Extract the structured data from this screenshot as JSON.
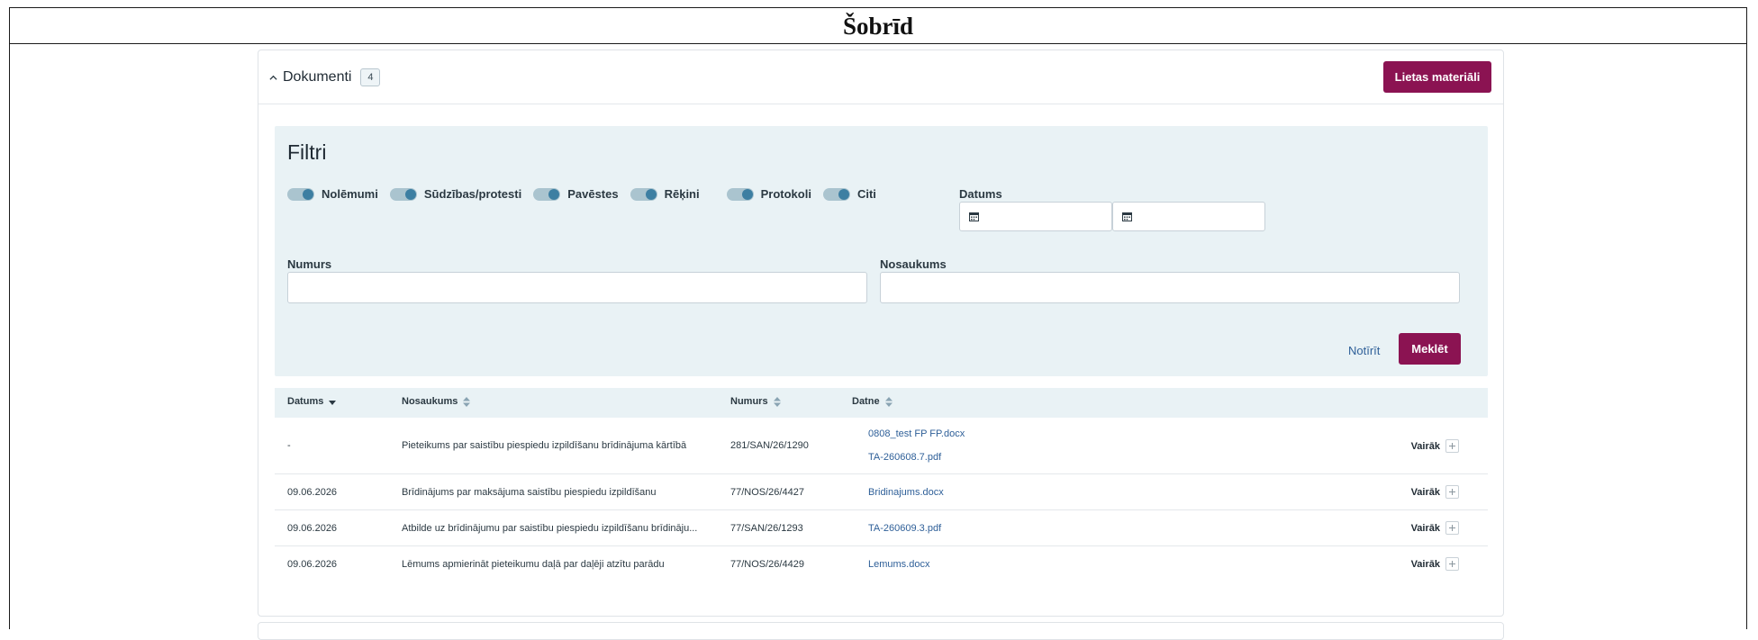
{
  "page": {
    "heading": "Šobrīd"
  },
  "documents": {
    "title": "Dokumenti",
    "count": "4",
    "case_materials_button": "Lietas materiāli"
  },
  "filters": {
    "title": "Filtri",
    "toggles": [
      {
        "label": "Nolēmumi",
        "checked": true
      },
      {
        "label": "Sūdzības/protesti",
        "checked": true
      },
      {
        "label": "Pavēstes",
        "checked": true
      },
      {
        "label": "Rēķini",
        "checked": true
      },
      {
        "label": "Protokoli",
        "checked": true
      },
      {
        "label": "Citi",
        "checked": true
      }
    ],
    "date_label": "Datums",
    "date_from": "",
    "date_to": "",
    "number_label": "Numurs",
    "number_value": "",
    "name_label": "Nosaukums",
    "name_value": "",
    "clear_label": "Notīrīt",
    "search_label": "Meklēt"
  },
  "table": {
    "columns": [
      "Datums",
      "Nosaukums",
      "Numurs",
      "Datne"
    ],
    "more_label": "Vairāk",
    "rows": [
      {
        "date": "-",
        "name": "Pieteikums par saistību piespiedu izpildīšanu brīdinājuma kārtībā",
        "number": "281/SAN/26/1290",
        "files": [
          "0808_test FP FP.docx",
          "TA-260608.7.pdf"
        ]
      },
      {
        "date": "09.06.2026",
        "name": "Brīdinājums par maksājuma saistību piespiedu izpildīšanu",
        "number": "77/NOS/26/4427",
        "files": [
          "Bridinajums.docx"
        ]
      },
      {
        "date": "09.06.2026",
        "name": "Atbilde uz brīdinājumu par saistību piespiedu izpildīšanu brīdināju...",
        "number": "77/SAN/26/1293",
        "files": [
          "TA-260609.3.pdf"
        ]
      },
      {
        "date": "09.06.2026",
        "name": "Lēmums apmierināt pieteikumu daļā par daļēji atzītu parādu",
        "number": "77/NOS/26/4429",
        "files": [
          "Lemums.docx"
        ]
      }
    ]
  }
}
